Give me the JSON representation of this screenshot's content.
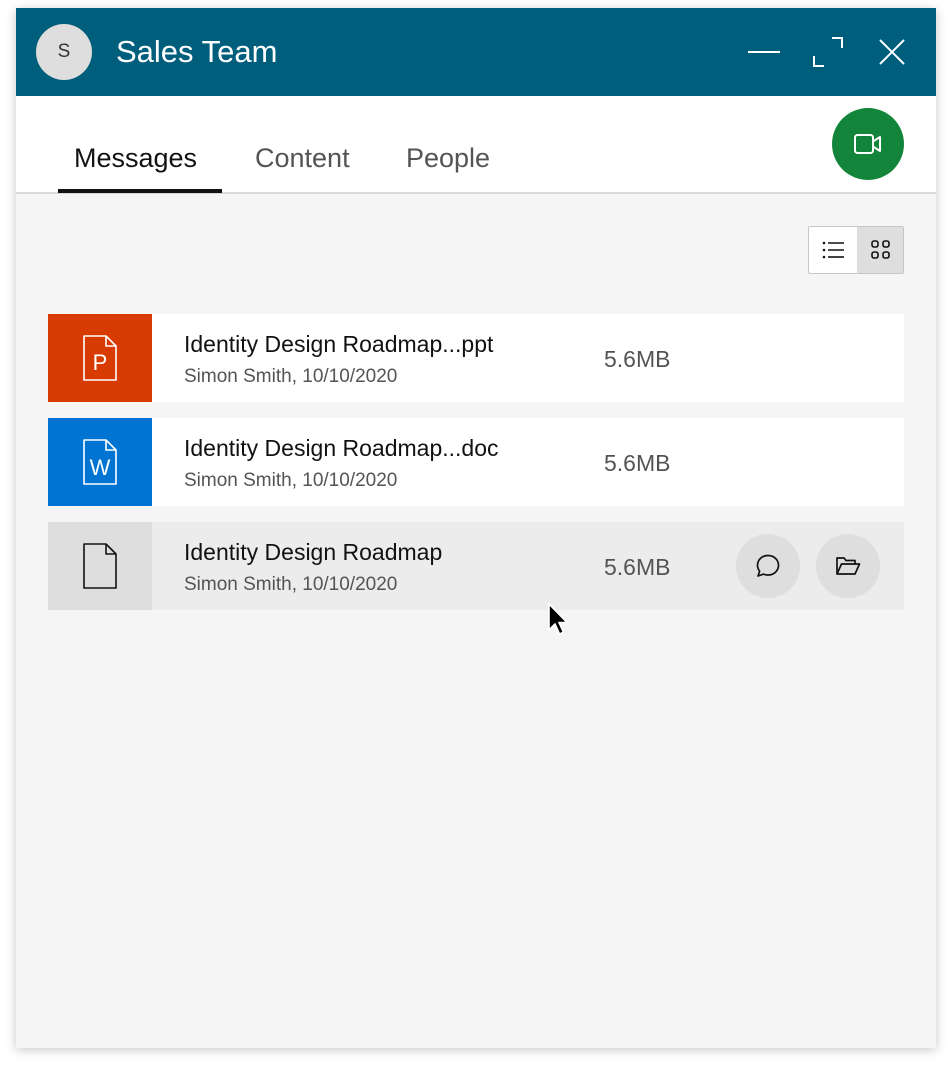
{
  "window": {
    "title": "Sales Team",
    "avatar_initial": "S",
    "controls": [
      "minimize-icon",
      "maximize-icon",
      "close-icon"
    ],
    "header_color": "#005e7d"
  },
  "tabs": [
    {
      "label": "Messages",
      "active": true
    },
    {
      "label": "Content",
      "active": false
    },
    {
      "label": "People",
      "active": false
    }
  ],
  "video_call": {
    "icon": "video-camera-icon",
    "color": "#12853a"
  },
  "view_toggle": {
    "options": [
      "list-view-icon",
      "grid-view-icon"
    ],
    "selected": "grid-view-icon"
  },
  "files": [
    {
      "name": "Identity Design Roadmap...ppt",
      "meta": "Simon Smith, 10/10/2020",
      "size": "5.6MB",
      "type_icon": "powerpoint-file-icon",
      "type_letter": "P",
      "thumb_color": "#d83b01"
    },
    {
      "name": "Identity Design Roadmap...doc",
      "meta": "Simon Smith, 10/10/2020",
      "size": "5.6MB",
      "type_icon": "word-file-icon",
      "type_letter": "W",
      "thumb_color": "#0074d3"
    },
    {
      "name": "Identity Design Roadmap",
      "meta": "Simon Smith, 10/10/2020",
      "size": "5.6MB",
      "type_icon": "generic-file-icon",
      "thumb_color": "#dedede",
      "hovered": true,
      "actions": [
        "chat-bubble-icon",
        "open-folder-icon"
      ]
    }
  ]
}
